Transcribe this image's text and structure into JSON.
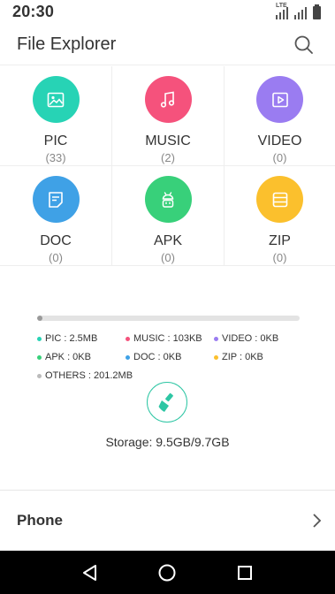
{
  "status_bar": {
    "time": "20:30",
    "network": "LTE"
  },
  "app_bar": {
    "title": "File Explorer"
  },
  "categories": [
    {
      "label": "PIC",
      "count": "(33)",
      "color": "#27d3b5",
      "icon": "image-icon"
    },
    {
      "label": "MUSIC",
      "count": "(2)",
      "color": "#f5527c",
      "icon": "music-note-icon"
    },
    {
      "label": "VIDEO",
      "count": "(0)",
      "color": "#9a7cf1",
      "icon": "play-icon"
    },
    {
      "label": "DOC",
      "count": "(0)",
      "color": "#3fa1e6",
      "icon": "document-icon"
    },
    {
      "label": "APK",
      "count": "(0)",
      "color": "#38d07a",
      "icon": "android-icon"
    },
    {
      "label": "ZIP",
      "count": "(0)",
      "color": "#fbc02d",
      "icon": "archive-icon"
    }
  ],
  "storage": {
    "used_fraction": 0.02,
    "legend": [
      {
        "label": "PIC : 2.5MB",
        "color": "#27d3b5"
      },
      {
        "label": "MUSIC : 103KB",
        "color": "#f5527c"
      },
      {
        "label": "VIDEO : 0KB",
        "color": "#9a7cf1"
      },
      {
        "label": "APK : 0KB",
        "color": "#38d07a"
      },
      {
        "label": "DOC : 0KB",
        "color": "#3fa1e6"
      },
      {
        "label": "ZIP : 0KB",
        "color": "#fbc02d"
      },
      {
        "label": "OTHERS : 201.2MB",
        "color": "#bbbbbb"
      }
    ],
    "summary": "Storage: 9.5GB/9.7GB",
    "clean_icon": "broom-icon",
    "clean_color": "#2ec6a4"
  },
  "phone": {
    "label": "Phone"
  }
}
